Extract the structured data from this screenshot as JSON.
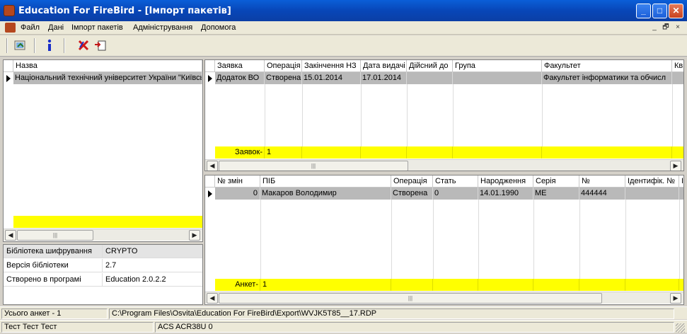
{
  "window": {
    "title": "Education For FireBird - [Імпорт пакетів]",
    "buttons": [
      "_",
      "□",
      "✕"
    ]
  },
  "menu": [
    "Файл",
    "Дані",
    "Імпорт пакетів",
    "Адміністрування",
    "Допомога"
  ],
  "mdi_buttons": [
    "_",
    "🗗",
    "×"
  ],
  "left_grid": {
    "header": "Назва",
    "rows": [
      "Національний технічний університет України \"Київсь"
    ]
  },
  "props": [
    {
      "key": "Бібліотека шифрування",
      "value": "CRYPTO"
    },
    {
      "key": "Версія бібліотеки",
      "value": "2.7"
    },
    {
      "key": "Створено в програмі",
      "value": "Education 2.0.2.2"
    }
  ],
  "top_grid": {
    "columns": [
      "Заявка",
      "Операція",
      "Закінчення НЗ",
      "Дата видачі",
      "Дійсний до",
      "Група",
      "Факультет",
      "Кв"
    ],
    "row": [
      "Додаток ВО",
      "Створена",
      "15.01.2014",
      "17.01.2014",
      "",
      "",
      "Факультет інформатики та обчисл",
      ""
    ],
    "footer_label": "Заявок-",
    "footer_value": "1"
  },
  "bottom_grid": {
    "columns": [
      "№ змін",
      "ПІБ",
      "Операція",
      "Стать",
      "Народження",
      "Серія",
      "№",
      "Ідентифік. №",
      "І"
    ],
    "row": [
      "0",
      "Макаров Володимир",
      "Створена",
      "0",
      "14.01.1990",
      "МЕ",
      "444444",
      "",
      ""
    ],
    "footer_label": "Анкет-",
    "footer_value": "1"
  },
  "status": {
    "total": "Усього анкет - 1",
    "path": "C:\\Program Files\\Osvita\\Education For FireBird\\Export\\WVJK5T85__17.RDP",
    "user": "Тест Тест Тест",
    "reader": "ACS ACR38U 0"
  },
  "colors": {
    "titlebar": "#0a5fd8",
    "footer": "#ffff00",
    "selected_row": "#b9b9b9"
  }
}
